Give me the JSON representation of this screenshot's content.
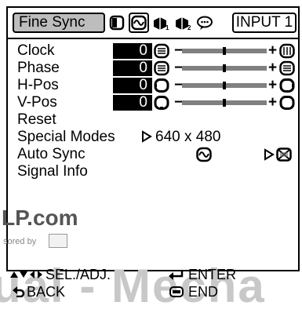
{
  "header": {
    "tab_label": "Fine Sync",
    "input_label": "INPUT 1",
    "tab_icons": [
      "picture-icon",
      "fine-sync-icon",
      "audio-icon",
      "options-icon",
      "language-icon"
    ]
  },
  "rows": [
    {
      "label": "Clock",
      "value": "0",
      "level": 0.5
    },
    {
      "label": "Phase",
      "value": "0",
      "level": 0.5
    },
    {
      "label": "H-Pos",
      "value": "0",
      "level": 0.5
    },
    {
      "label": "V-Pos",
      "value": "0",
      "level": 0.5
    }
  ],
  "items": {
    "reset": "Reset",
    "special_modes": "Special Modes",
    "special_modes_value": "640 x 480",
    "auto_sync": "Auto Sync",
    "signal_info": "Signal Info"
  },
  "footer": {
    "sel_adj": "SEL./ADJ.",
    "enter": "ENTER",
    "back": "BACK",
    "end": "END"
  },
  "watermark": {
    "text1": "LP.com",
    "text2": "sored by",
    "text3": "ual - Mecha"
  }
}
